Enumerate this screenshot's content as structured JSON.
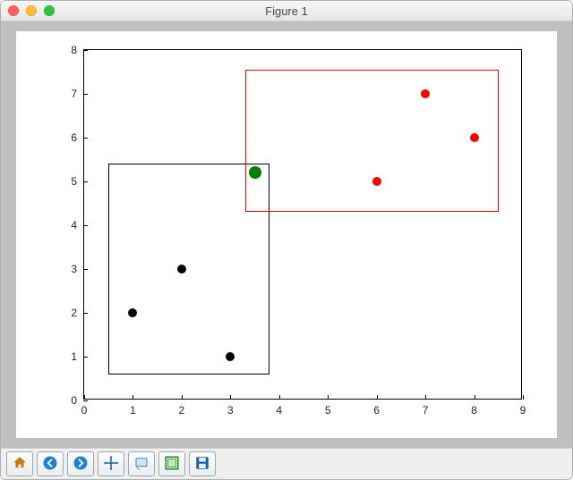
{
  "window": {
    "title": "Figure 1"
  },
  "chart_data": {
    "type": "scatter",
    "xlim": [
      0,
      9
    ],
    "ylim": [
      0,
      8
    ],
    "xticks": [
      0,
      1,
      2,
      3,
      4,
      5,
      6,
      7,
      8,
      9
    ],
    "yticks": [
      0,
      1,
      2,
      3,
      4,
      5,
      6,
      7,
      8
    ],
    "series": [
      {
        "name": "black",
        "color": "#000000",
        "points": [
          [
            1,
            2
          ],
          [
            2,
            3
          ],
          [
            3,
            1
          ]
        ]
      },
      {
        "name": "red",
        "color": "#ff0000",
        "points": [
          [
            6,
            5
          ],
          [
            7,
            7
          ],
          [
            8,
            6
          ]
        ]
      },
      {
        "name": "green",
        "color": "#008000",
        "points": [
          [
            3.5,
            5.2
          ]
        ],
        "size": "big"
      }
    ],
    "rectangles": [
      {
        "name": "black-box",
        "color": "#000000",
        "x0": 0.5,
        "y0": 0.6,
        "x1": 3.8,
        "y1": 5.4
      },
      {
        "name": "red-box",
        "color": "#ff0000",
        "x0": 3.3,
        "y0": 4.3,
        "x1": 8.5,
        "y1": 7.55
      }
    ]
  },
  "toolbar": {
    "home": "Home",
    "back": "Back",
    "forward": "Forward",
    "pan": "Pan",
    "zoom": "Zoom",
    "subplots": "Configure subplots",
    "save": "Save"
  }
}
